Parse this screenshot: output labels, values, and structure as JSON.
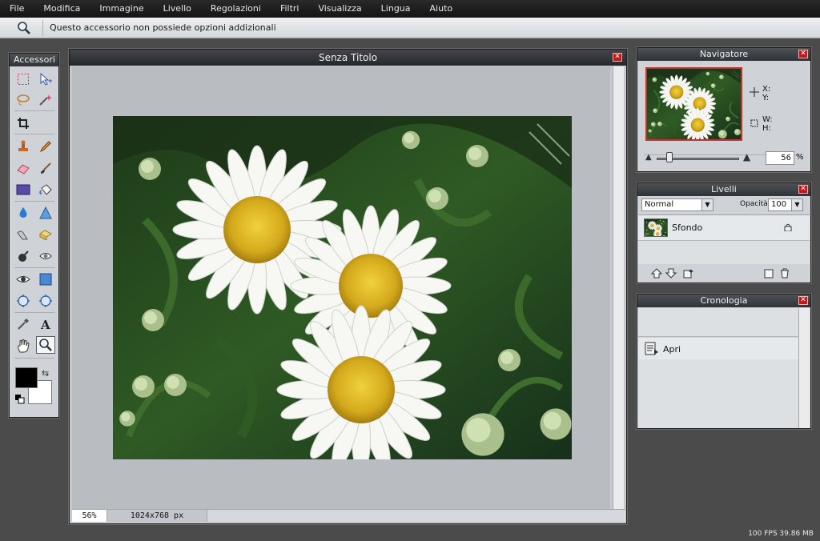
{
  "menubar": {
    "items": [
      "File",
      "Modifica",
      "Immagine",
      "Livello",
      "Regolazioni",
      "Filtri",
      "Visualizza",
      "Lingua",
      "Aiuto"
    ]
  },
  "options_bar": {
    "tool_icon": "magnifier-icon",
    "message": "Questo accessorio non possiede opzioni addizionali"
  },
  "tools_panel": {
    "title": "Accessori",
    "tools": [
      "marquee-icon",
      "move-icon",
      "lasso-icon",
      "wand-icon",
      "crop-icon",
      "pencil-icon",
      "stamp-icon",
      "brush-icon",
      "eraser-icon",
      "smudge-icon",
      "rectangle-icon",
      "bucket-icon",
      "drop-icon",
      "triangle-icon",
      "sponge-icon",
      "dodge-icon",
      "burn-icon",
      "redeye-icon",
      "eye-icon",
      "shape-icon",
      "bloat-icon",
      "pinch-icon",
      "eyedropper-icon",
      "text-icon",
      "hand-icon",
      "zoom-icon"
    ],
    "active_tool": "zoom-icon",
    "foreground_color": "#000000",
    "background_color": "#ffffff"
  },
  "document": {
    "title": "Senza Titolo",
    "zoom": "56%",
    "size": "1024x768 px"
  },
  "navigator": {
    "title": "Navigatore",
    "x_label": "X:",
    "y_label": "Y:",
    "w_label": "W:",
    "h_label": "H:",
    "zoom_value": "56",
    "zoom_unit": "%"
  },
  "layers": {
    "title": "Livelli",
    "blend_mode": "Normal",
    "opacity_label": "Opacità:",
    "opacity_value": "100",
    "items": [
      {
        "name": "Sfondo",
        "locked": true
      }
    ]
  },
  "history": {
    "title": "Cronologia",
    "items": [
      "Apri"
    ]
  },
  "status": {
    "perf": "100 FPS 39.86 MB"
  },
  "colors": {
    "accent_red": "#c31616",
    "panel_bg": "#cfd3d7",
    "workspace_bg": "#4b4b4b"
  }
}
